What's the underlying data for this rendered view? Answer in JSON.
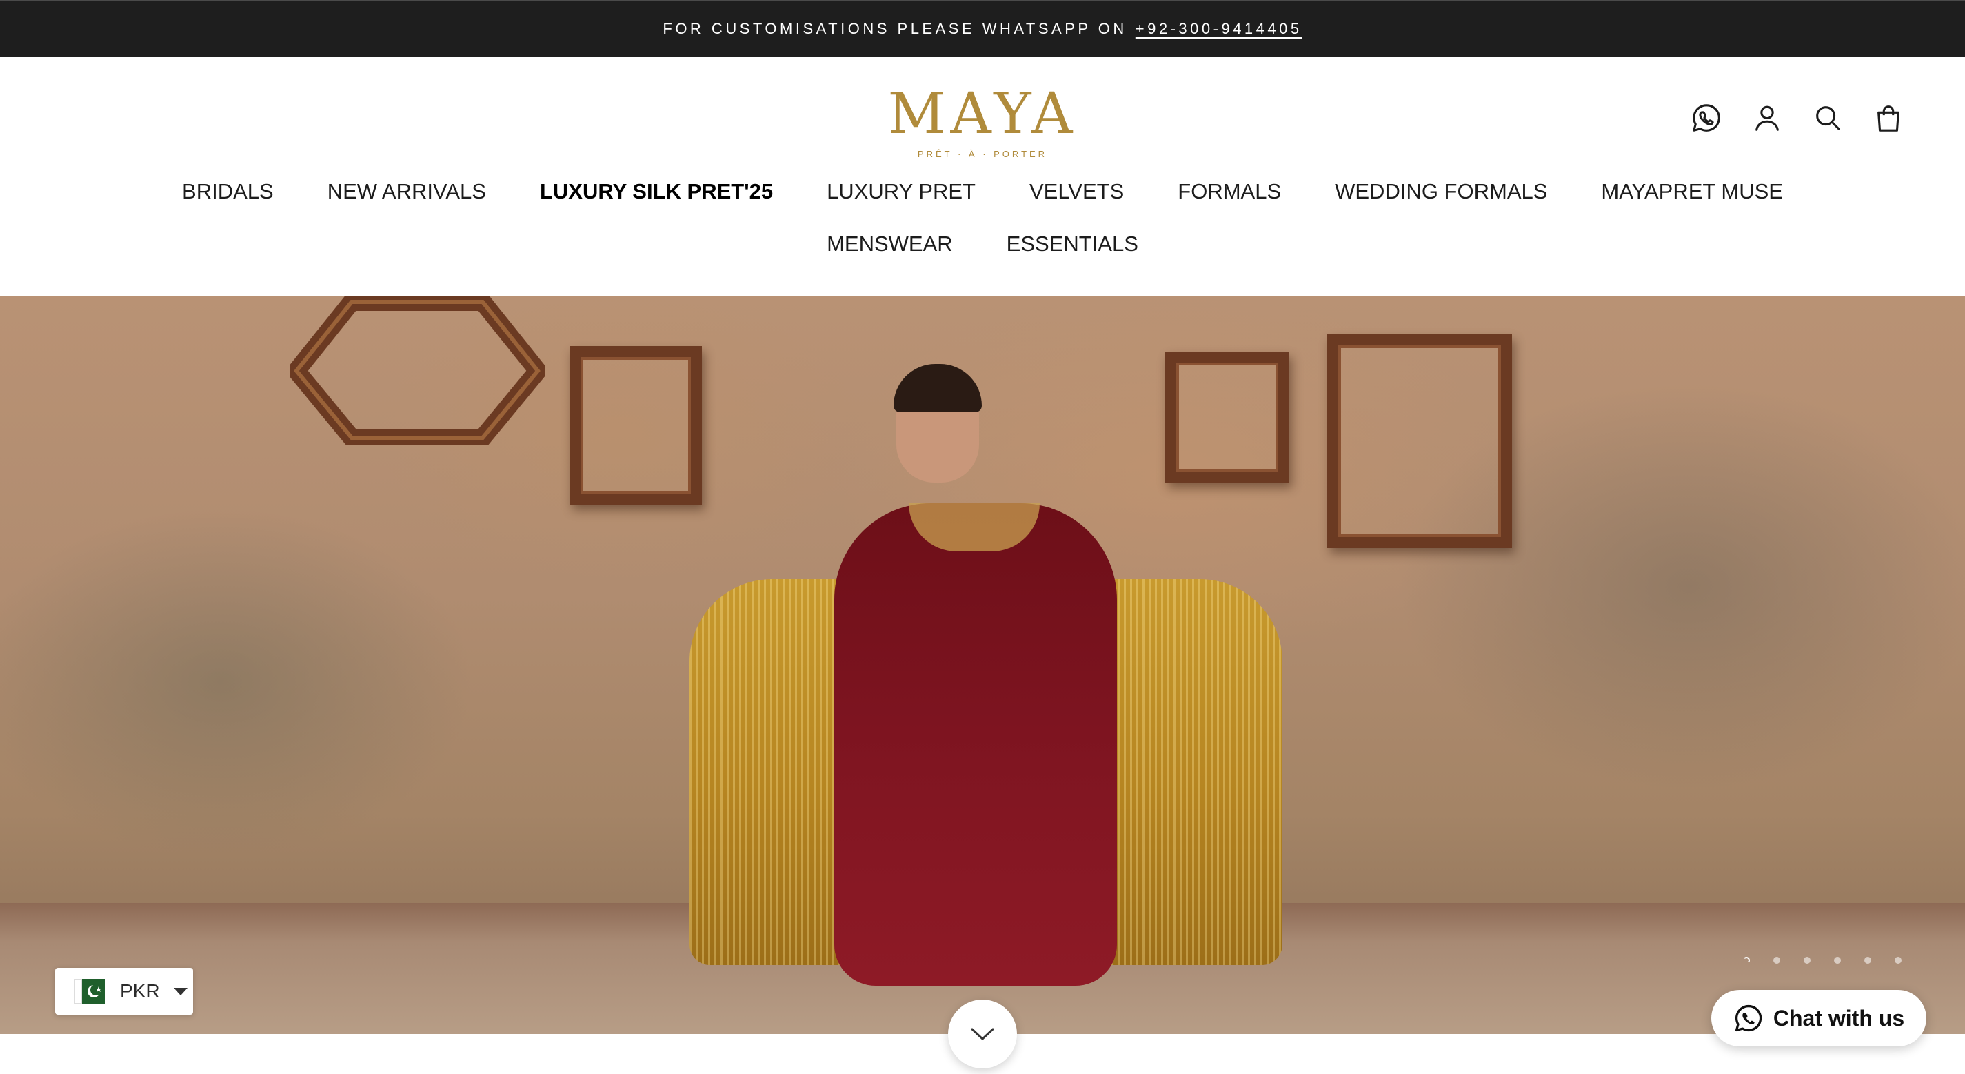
{
  "announcement": {
    "text": "FOR CUSTOMISATIONS PLEASE WHATSAPP ON",
    "phone": "+92-300-9414405"
  },
  "header": {
    "logo": "MAYA",
    "logo_tagline": "PRÊT · À · PORTER",
    "icons": [
      "whatsapp-icon",
      "account-icon",
      "search-icon",
      "cart-icon"
    ]
  },
  "nav": {
    "items": [
      {
        "label": "BRIDALS"
      },
      {
        "label": "NEW ARRIVALS"
      },
      {
        "label": "LUXURY SILK PRET'25"
      },
      {
        "label": "LUXURY PRET"
      },
      {
        "label": "VELVETS"
      },
      {
        "label": "FORMALS"
      },
      {
        "label": "WEDDING FORMALS"
      },
      {
        "label": "MAYAPRET MUSE"
      },
      {
        "label": "MENSWEAR"
      },
      {
        "label": "ESSENTIALS"
      }
    ],
    "active_index": 2
  },
  "hero": {
    "slide_count": 6,
    "active_slide": 1,
    "colors": {
      "wall": "#b08c70",
      "dress": "#7d1420",
      "chair": "#b68521"
    }
  },
  "currency": {
    "code": "PKR",
    "flag": "pakistan-flag-icon"
  },
  "chat": {
    "label": "Chat with us"
  },
  "colors": {
    "announcement_bg": "#1e1e1e",
    "logo_gold": "#b08b3b"
  }
}
